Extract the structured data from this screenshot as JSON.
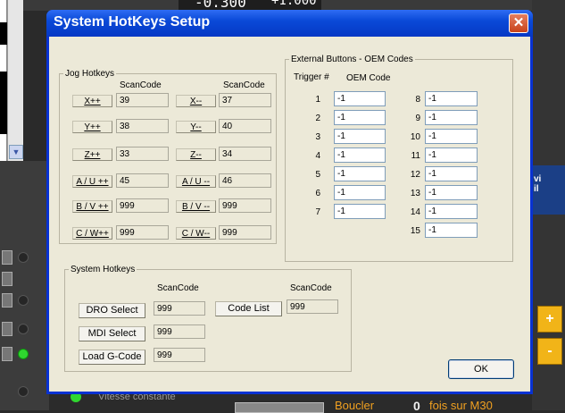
{
  "background": {
    "readout_left": "-0.300",
    "readout_right": "+1.000",
    "blue_panel_text": "vi\nil",
    "status_text": "Vitesse constante",
    "bottom_label_1": "Boucler",
    "bottom_count": "0",
    "bottom_label_2": "fois sur M30",
    "arrow_up": "+",
    "arrow_down": "-",
    "scroll_arrow": "▼"
  },
  "dialog": {
    "title": "System HotKeys Setup",
    "close_glyph": "✕",
    "ok_label": "OK"
  },
  "jog": {
    "legend": "Jog Hotkeys",
    "scancode_header": "ScanCode",
    "rows": [
      {
        "left_label": "X++",
        "left_code": "39",
        "right_label": "X--",
        "right_code": "37"
      },
      {
        "left_label": "Y++",
        "left_code": "38",
        "right_label": "Y--",
        "right_code": "40"
      },
      {
        "left_label": "Z++",
        "left_code": "33",
        "right_label": "Z--",
        "right_code": "34"
      },
      {
        "left_label": "A / U ++",
        "left_code": "45",
        "right_label": "A / U --",
        "right_code": "46"
      },
      {
        "left_label": "B / V ++",
        "left_code": "999",
        "right_label": "B / V --",
        "right_code": "999"
      },
      {
        "left_label": "C / W++",
        "left_code": "999",
        "right_label": "C / W--",
        "right_code": "999"
      }
    ]
  },
  "external": {
    "legend": "External Buttons - OEM Codes",
    "trigger_header": "Trigger  #",
    "oem_header": "OEM Code",
    "left": [
      {
        "num": "1",
        "value": "-1"
      },
      {
        "num": "2",
        "value": "-1"
      },
      {
        "num": "3",
        "value": "-1"
      },
      {
        "num": "4",
        "value": "-1"
      },
      {
        "num": "5",
        "value": "-1"
      },
      {
        "num": "6",
        "value": "-1"
      },
      {
        "num": "7",
        "value": "-1"
      }
    ],
    "right": [
      {
        "num": "8",
        "value": "-1"
      },
      {
        "num": "9",
        "value": "-1"
      },
      {
        "num": "10",
        "value": "-1"
      },
      {
        "num": "11",
        "value": "-1"
      },
      {
        "num": "12",
        "value": "-1"
      },
      {
        "num": "13",
        "value": "-1"
      },
      {
        "num": "14",
        "value": "-1"
      },
      {
        "num": "15",
        "value": "-1"
      }
    ]
  },
  "system": {
    "legend": "System Hotkeys",
    "scancode_header": "ScanCode",
    "dro_label": "DRO Select",
    "dro_code": "999",
    "mdi_label": "MDI Select",
    "mdi_code": "999",
    "load_label": "Load G-Code",
    "load_code": "999",
    "codelist_label": "Code List",
    "codelist_code": "999"
  },
  "colors": {
    "titlebar": "#0a4ad8",
    "client": "#ece9d8",
    "close_button": "#c8431a"
  }
}
